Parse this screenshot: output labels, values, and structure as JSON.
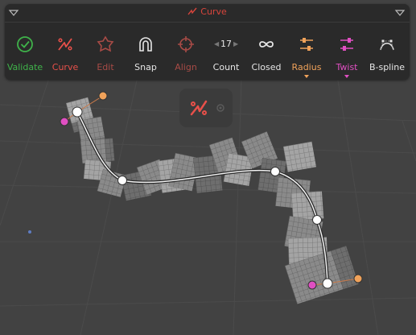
{
  "header": {
    "title": "Curve",
    "collapse_icon": "triangle-down-icon",
    "menu_icon": "triangle-down-icon"
  },
  "colors": {
    "green": "#3fb24a",
    "red": "#e8504a",
    "dim_red": "#a84b46",
    "white": "#e6e6e6",
    "orange": "#f0a25a",
    "pink": "#e04fc2",
    "panel": "#2a2a2a",
    "viewport": "#424242"
  },
  "tools": [
    {
      "id": "validate",
      "label": "Validate",
      "icon": "check-circle-icon",
      "color": "#3fb24a"
    },
    {
      "id": "curve",
      "label": "Curve",
      "icon": "curve-icon",
      "color": "#e8504a"
    },
    {
      "id": "edit",
      "label": "Edit",
      "icon": "edit-shape-icon",
      "color": "#a84b46"
    },
    {
      "id": "snap",
      "label": "Snap",
      "icon": "magnet-icon",
      "color": "#e6e6e6"
    },
    {
      "id": "align",
      "label": "Align",
      "icon": "crosshair-icon",
      "color": "#a84b46"
    },
    {
      "id": "count",
      "label": "Count",
      "value": "17",
      "color": "#e6e6e6"
    },
    {
      "id": "closed",
      "label": "Closed",
      "icon": "infinity-icon",
      "color": "#e6e6e6"
    },
    {
      "id": "radius",
      "label": "Radius",
      "icon": "radius-slider-icon",
      "color": "#f0a25a"
    },
    {
      "id": "twist",
      "label": "Twist",
      "icon": "twist-slider-icon",
      "color": "#e04fc2"
    },
    {
      "id": "bspline",
      "label": "B-spline",
      "icon": "bspline-icon",
      "color": "#e6e6e6"
    }
  ],
  "viewport": {
    "floating_button_icon": "curve-icon",
    "floating_button_secondary_icon": "gear-icon"
  }
}
